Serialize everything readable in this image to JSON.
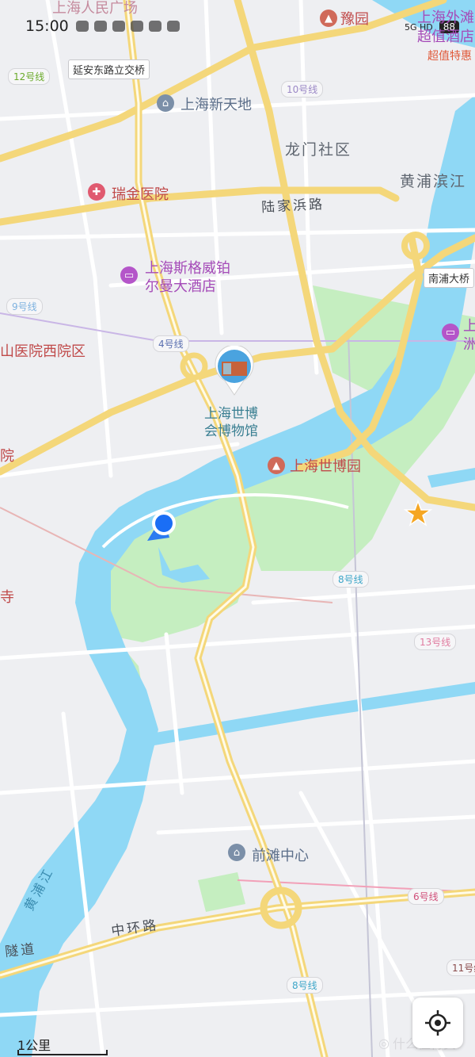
{
  "status_bar": {
    "time": "15:00",
    "network": "5G HD",
    "battery": "88"
  },
  "labels": {
    "people_square": "上海人民广场",
    "yanan_bridge": "延安东路立交桥",
    "xintiandi": "上海新天地",
    "longmen": "龙门社区",
    "huangpu_bank": "黄浦滨江",
    "ruijin": "瑞金医院",
    "lujiabang": "陆家浜路",
    "sheraton_line1": "上海斯格威铂",
    "sheraton_line2": "尔曼大酒店",
    "hospital_west": "山医院西院区",
    "yuan_partial": "院",
    "si_partial": "寺",
    "museum_line1": "上海世博",
    "museum_line2": "会博物馆",
    "expo_park": "上海世博园",
    "qiantan": "前滩中心",
    "zhonghuan": "中环路",
    "tunnel": "隧道",
    "huangpu_river": "黄浦江",
    "yuyuan": "豫园",
    "waitan_line1": "上海外滩",
    "waitan_line2": "超值酒店",
    "chaozhi": "超值特惠",
    "nanpu_bridge": "南浦大桥",
    "zhou_partial": "洲",
    "shang_partial": "上"
  },
  "metro_lines": {
    "l12": "12号线",
    "l10": "10号线",
    "l9": "9号线",
    "l4": "4号线",
    "l8a": "8号线",
    "l13": "13号线",
    "l6": "6号线",
    "l11": "11号线",
    "l8b": "8号线"
  },
  "scale": {
    "label": "1公里"
  },
  "watermark": {
    "text": "什么值得买"
  },
  "icons": {
    "poi_pin": "pin-icon",
    "hospital": "hospital-cross-icon",
    "hotel": "bed-icon",
    "park": "park-icon",
    "locate": "crosshair-icon",
    "star": "star-icon",
    "current_location": "location-dot-icon"
  },
  "colors": {
    "water": "#8fd8f5",
    "park": "#c5eec0",
    "major_road": "#f4d77a",
    "minor_road": "#ffffff",
    "background": "#eeeff2",
    "location": "#1a6ef5"
  }
}
